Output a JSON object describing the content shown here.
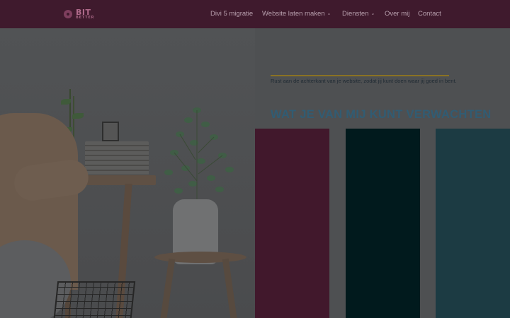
{
  "header": {
    "logo": {
      "text_top": "BIT",
      "text_bottom": "BETTER"
    },
    "nav": [
      {
        "label": "Divi 5 migratie",
        "has_dropdown": false
      },
      {
        "label": "Website laten maken",
        "has_dropdown": true
      },
      {
        "label": "Diensten",
        "has_dropdown": true
      },
      {
        "label": "Over mij",
        "has_dropdown": false
      },
      {
        "label": "Contact",
        "has_dropdown": false
      }
    ],
    "dropdown_icon": "⌄"
  },
  "hero": {
    "tagline": "Rust aan de achterkant van je website, zodat jij kunt doen waar jij goed in bent."
  },
  "section": {
    "title": "WAT JE VAN MIJ KUNT VERWACHTEN"
  },
  "colors": {
    "header_bg": "#3f1a2d",
    "accent_line": "#8a7224",
    "title": "#315c73",
    "card_1": "#41182c",
    "card_2": "#011a1d",
    "card_3": "#1c3b43"
  }
}
